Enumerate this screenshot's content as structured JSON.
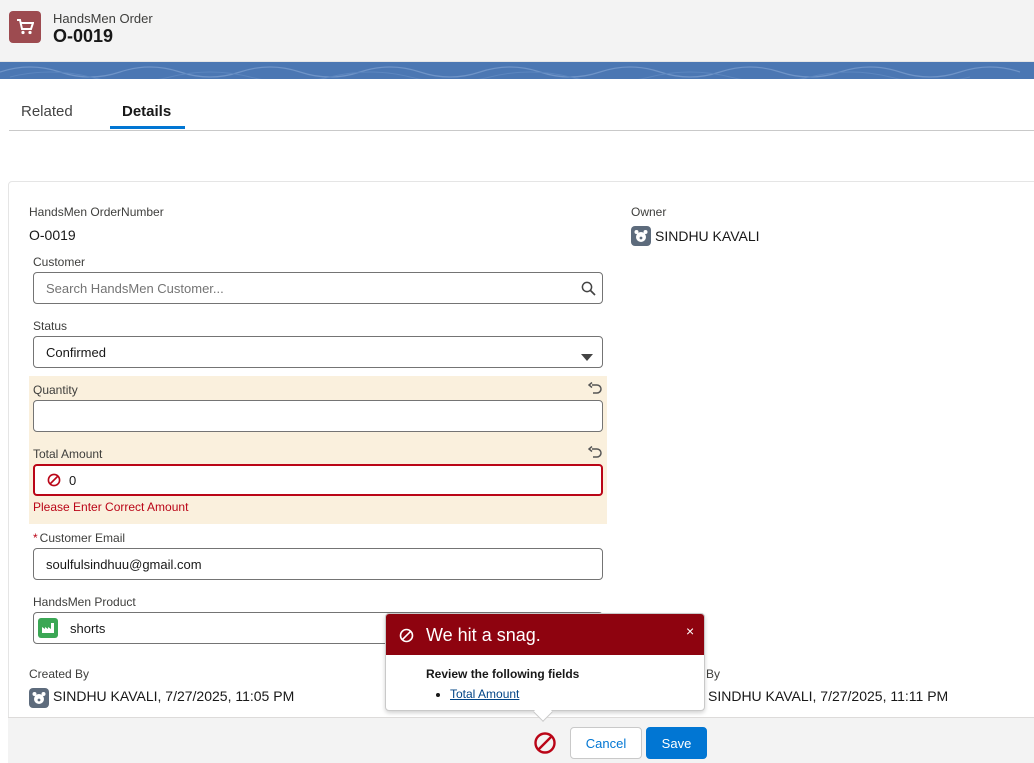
{
  "header": {
    "object_label": "HandsMen Order",
    "record_title": "O-0019",
    "icon": "cart-icon",
    "icon_color": "#9d4b50"
  },
  "tabs": [
    {
      "label": "Related",
      "active": false
    },
    {
      "label": "Details",
      "active": true
    }
  ],
  "fields": {
    "order_number": {
      "label": "HandsMen OrderNumber",
      "value": "O-0019"
    },
    "owner": {
      "label": "Owner",
      "value": "SINDHU KAVALI"
    },
    "customer": {
      "label": "Customer",
      "placeholder": "Search HandsMen Customer..."
    },
    "status": {
      "label": "Status",
      "value": "Confirmed"
    },
    "quantity": {
      "label": "Quantity",
      "value": ""
    },
    "total_amount": {
      "label": "Total Amount",
      "value": "0",
      "error": "Please Enter Correct Amount"
    },
    "customer_email": {
      "label": "Customer Email",
      "required_mark": "*",
      "value": "soulfulsindhuu@gmail.com"
    },
    "product": {
      "label": "HandsMen Product",
      "value": "shorts"
    },
    "created_by": {
      "label": "Created By",
      "value": "SINDHU KAVALI, 7/27/2025, 11:05 PM"
    },
    "modified_by": {
      "label_suffix": "By",
      "value": "SINDHU KAVALI, 7/27/2025, 11:11 PM"
    }
  },
  "error_popover": {
    "title": "We hit a snag.",
    "close": "×",
    "review_label": "Review the following fields",
    "fields": [
      "Total Amount"
    ]
  },
  "footer": {
    "cancel_label": "Cancel",
    "save_label": "Save"
  },
  "colors": {
    "brand_blue": "#0176d3",
    "error_red": "#ba0517",
    "snag_header": "#8e030f",
    "highlight": "#faf0dd"
  }
}
